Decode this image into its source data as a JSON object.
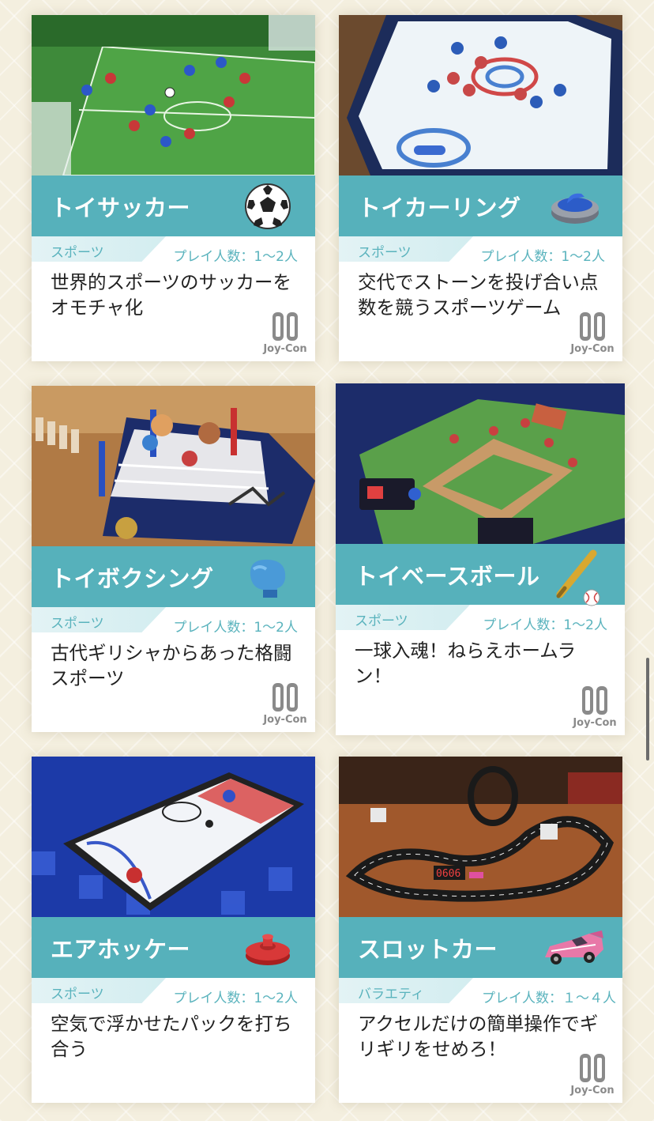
{
  "colors": {
    "accent": "#56b1bb",
    "accent_text": "#5ab3bd",
    "background": "#f4efdf"
  },
  "cards": [
    {
      "title": "トイサッカー",
      "icon": "soccer-ball-icon",
      "image": "toy-soccer-table-image",
      "category": "スポーツ",
      "players": "プレイ人数：1～2人",
      "description": "世界的スポーツのサッカーをオモチャ化",
      "controller_label": "Joy-Con"
    },
    {
      "title": "トイカーリング",
      "icon": "curling-stone-icon",
      "image": "toy-curling-table-image",
      "category": "スポーツ",
      "players": "プレイ人数：1～2人",
      "description": "交代でストーンを投げ合い点数を競うスポーツゲーム",
      "controller_label": "Joy-Con"
    },
    {
      "title": "トイボクシング",
      "icon": "boxing-glove-icon",
      "image": "toy-boxing-ring-image",
      "category": "スポーツ",
      "players": "プレイ人数：1～2人",
      "description": "古代ギリシャからあった格闘スポーツ",
      "controller_label": "Joy-Con"
    },
    {
      "title": "トイベースボール",
      "icon": "baseball-bat-icon",
      "image": "toy-baseball-field-image",
      "category": "スポーツ",
      "players": "プレイ人数：1～2人",
      "description": "一球入魂！ねらえホームラン！",
      "controller_label": "Joy-Con"
    },
    {
      "title": "エアホッケー",
      "icon": "air-hockey-mallet-icon",
      "image": "air-hockey-table-image",
      "category": "スポーツ",
      "players": "プレイ人数：1～2人",
      "description": "空気で浮かせたパックを打ち合う",
      "controller_label": ""
    },
    {
      "title": "スロットカー",
      "icon": "race-car-icon",
      "image": "slot-car-track-image",
      "category": "バラエティ",
      "players": "プレイ人数：１～４人",
      "description": "アクセルだけの簡単操作でギリギリをせめろ！",
      "controller_label": "Joy-Con"
    }
  ]
}
